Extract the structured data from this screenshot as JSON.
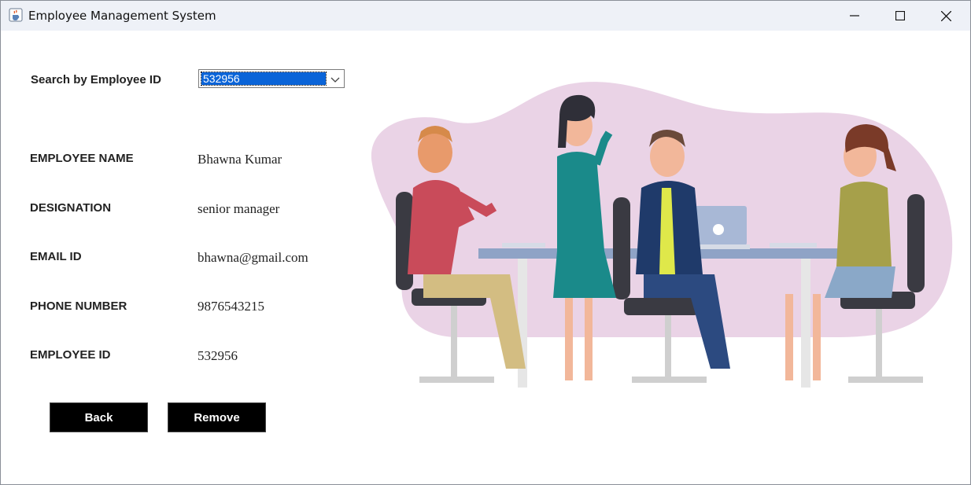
{
  "window": {
    "title": "Employee Management System",
    "icon": "java-cup-icon",
    "controls": [
      "minimize-icon",
      "maximize-icon",
      "close-icon"
    ]
  },
  "search": {
    "label": "Search by Employee ID",
    "selected_value": "532956"
  },
  "fields": {
    "name": {
      "label": "EMPLOYEE NAME",
      "value": "Bhawna Kumar"
    },
    "designation": {
      "label": "DESIGNATION",
      "value": "senior manager"
    },
    "email": {
      "label": "EMAIL ID",
      "value": "bhawna@gmail.com"
    },
    "phone": {
      "label": "PHONE NUMBER",
      "value": "9876543215"
    },
    "id": {
      "label": "EMPLOYEE ID",
      "value": "532956"
    }
  },
  "buttons": {
    "back": "Back",
    "remove": "Remove"
  },
  "colors": {
    "selection_blue": "#0a64d8",
    "button_bg": "#000000",
    "blob_pink": "#ead3e6"
  }
}
